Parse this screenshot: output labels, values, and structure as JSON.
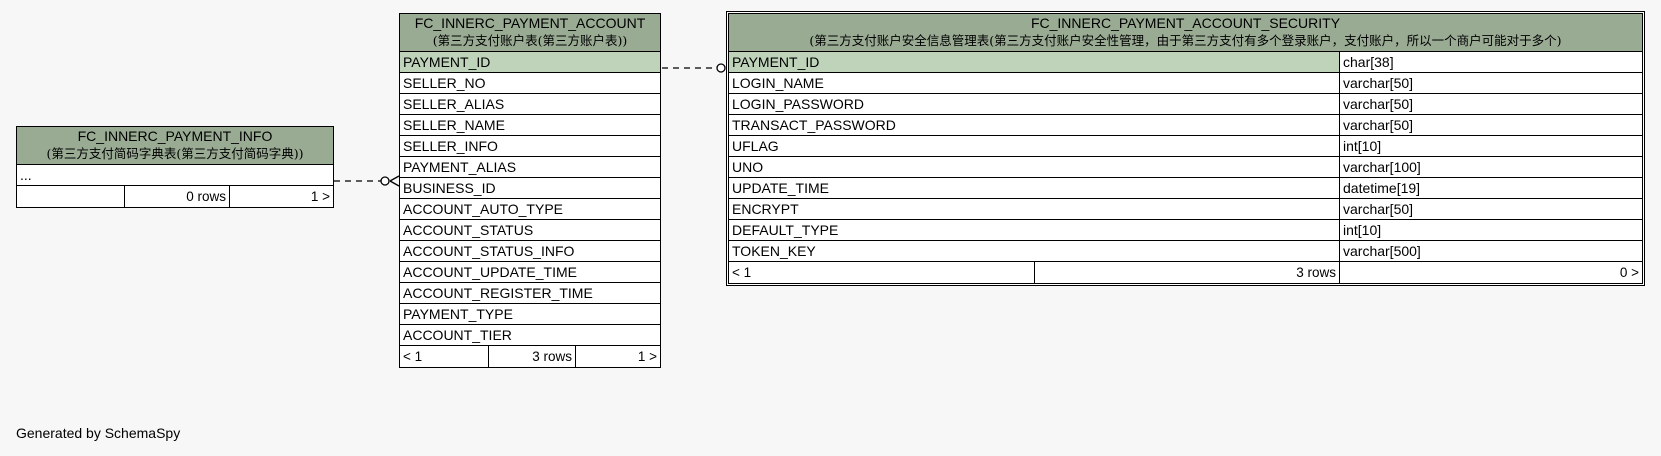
{
  "tables": {
    "info": {
      "name": "FC_INNERC_PAYMENT_INFO",
      "comment": "(第三方支付简码字典表(第三方支付简码字典))",
      "rows": [
        "..."
      ],
      "footer": {
        "left": "",
        "mid": "0 rows",
        "right": "1 >"
      }
    },
    "account": {
      "name": "FC_INNERC_PAYMENT_ACCOUNT",
      "comment": "(第三方支付账户表(第三方账户表))",
      "rows": [
        "PAYMENT_ID",
        "SELLER_NO",
        "SELLER_ALIAS",
        "SELLER_NAME",
        "SELLER_INFO",
        "PAYMENT_ALIAS",
        "BUSINESS_ID",
        "ACCOUNT_AUTO_TYPE",
        "ACCOUNT_STATUS",
        "ACCOUNT_STATUS_INFO",
        "ACCOUNT_UPDATE_TIME",
        "ACCOUNT_REGISTER_TIME",
        "PAYMENT_TYPE",
        "ACCOUNT_TIER"
      ],
      "footer": {
        "left": "< 1",
        "mid": "3 rows",
        "right": "1 >"
      }
    },
    "security": {
      "name": "FC_INNERC_PAYMENT_ACCOUNT_SECURITY",
      "comment": "(第三方支付账户安全信息管理表(第三方支付账户安全性管理，由于第三方支付有多个登录账户，支付账户，所以一个商户可能对于多个)",
      "rows": [
        {
          "col": "PAYMENT_ID",
          "type": "char[38]"
        },
        {
          "col": "LOGIN_NAME",
          "type": "varchar[50]"
        },
        {
          "col": "LOGIN_PASSWORD",
          "type": "varchar[50]"
        },
        {
          "col": "TRANSACT_PASSWORD",
          "type": "varchar[50]"
        },
        {
          "col": "UFLAG",
          "type": "int[10]"
        },
        {
          "col": "UNO",
          "type": "varchar[100]"
        },
        {
          "col": "UPDATE_TIME",
          "type": "datetime[19]"
        },
        {
          "col": "ENCRYPT",
          "type": "varchar[50]"
        },
        {
          "col": "DEFAULT_TYPE",
          "type": "int[10]"
        },
        {
          "col": "TOKEN_KEY",
          "type": "varchar[500]"
        }
      ],
      "footer": {
        "left": "< 1",
        "mid": "3 rows",
        "right": "0 >"
      }
    }
  },
  "generated_by": "Generated by SchemaSpy",
  "colors": {
    "header": "#9aab94",
    "primary_key": "#bfd3ba",
    "background": "#f7f7f7"
  }
}
